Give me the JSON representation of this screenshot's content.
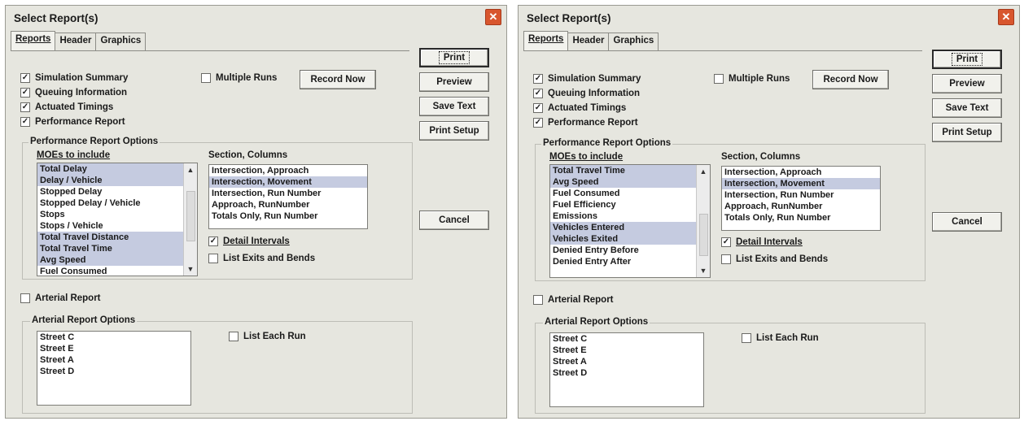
{
  "colors": {
    "dialog_bg": "#e6e6df",
    "selection": "#c5cbe0",
    "close_button": "#d8562e"
  },
  "dialogs": [
    {
      "title": "Select Report(s)",
      "tabs": [
        "Reports",
        "Header",
        "Graphics"
      ],
      "buttons": {
        "print": "Print",
        "preview": "Preview",
        "save_text": "Save Text",
        "print_setup": "Print Setup",
        "cancel": "Cancel",
        "record_now": "Record Now"
      },
      "checks": {
        "simulation_summary": "Simulation Summary",
        "queuing_information": "Queuing Information",
        "actuated_timings": "Actuated Timings",
        "performance_report": "Performance Report",
        "multiple_runs": "Multiple Runs",
        "detail_intervals": "Detail Intervals",
        "list_exits_bends": "List Exits and Bends",
        "arterial_report": "Arterial Report",
        "list_each_run": "List Each Run"
      },
      "performance_options_label": "Performance Report Options",
      "moes_label": "MOEs to include",
      "moes": [
        "Total Delay",
        "Delay / Vehicle",
        "Stopped Delay",
        "Stopped Delay / Vehicle",
        "Stops",
        "Stops / Vehicle",
        "Total Travel Distance",
        "Total Travel Time",
        "Avg Speed",
        "Fuel Consumed"
      ],
      "section_label": "Section, Columns",
      "sections": [
        "Intersection, Approach",
        "Intersection, Movement",
        "Intersection, Run Number",
        "Approach, RunNumber",
        "Totals Only, Run Number"
      ],
      "arterial_options_label": "Arterial Report Options",
      "streets": [
        "Street C",
        "Street E",
        "Street A",
        "Street D"
      ]
    },
    {
      "title": "Select Report(s)",
      "tabs": [
        "Reports",
        "Header",
        "Graphics"
      ],
      "buttons": {
        "print": "Print",
        "preview": "Preview",
        "save_text": "Save Text",
        "print_setup": "Print Setup",
        "cancel": "Cancel",
        "record_now": "Record Now"
      },
      "checks": {
        "simulation_summary": "Simulation Summary",
        "queuing_information": "Queuing Information",
        "actuated_timings": "Actuated Timings",
        "performance_report": "Performance Report",
        "multiple_runs": "Multiple Runs",
        "detail_intervals": "Detail Intervals",
        "list_exits_bends": "List Exits and Bends",
        "arterial_report": "Arterial Report",
        "list_each_run": "List Each Run"
      },
      "performance_options_label": "Performance Report Options",
      "moes_label": "MOEs to include",
      "moes": [
        "Total Travel Time",
        "Avg Speed",
        "Fuel Consumed",
        "Fuel Efficiency",
        "Emissions",
        "Vehicles Entered",
        "Vehicles Exited",
        "Denied Entry Before",
        "Denied Entry After"
      ],
      "section_label": "Section, Columns",
      "sections": [
        "Intersection, Approach",
        "Intersection, Movement",
        "Intersection, Run Number",
        "Approach, RunNumber",
        "Totals Only, Run Number"
      ],
      "arterial_options_label": "Arterial Report Options",
      "streets": [
        "Street C",
        "Street E",
        "Street A",
        "Street D"
      ]
    }
  ]
}
